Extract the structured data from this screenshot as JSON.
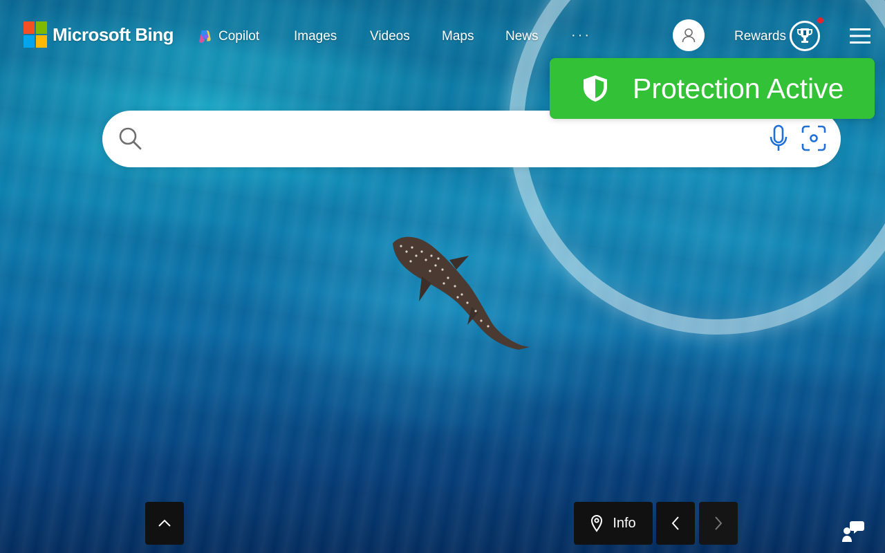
{
  "brand": {
    "name": "Microsoft Bing",
    "logo_colors": [
      "#f25022",
      "#7fba00",
      "#00a4ef",
      "#ffb900"
    ]
  },
  "nav": {
    "items": [
      {
        "label": "Copilot",
        "icon": "copilot-icon"
      },
      {
        "label": "Images"
      },
      {
        "label": "Videos"
      },
      {
        "label": "Maps"
      },
      {
        "label": "News"
      }
    ],
    "more_label": "···"
  },
  "account": {
    "profile_icon": "user-icon",
    "rewards_label": "Rewards",
    "rewards_icon": "trophy-icon",
    "notification_color": "#e3262c",
    "menu_icon": "hamburger-menu-icon"
  },
  "protection": {
    "label": "Protection Active",
    "icon": "shield-icon",
    "color": "#33c137"
  },
  "search": {
    "value": "",
    "placeholder": "",
    "search_icon": "search-icon",
    "mic_icon": "microphone-icon",
    "visual_search_icon": "visual-search-icon"
  },
  "background": {
    "subject": "whale-shark-in-ocean"
  },
  "bottom_controls": {
    "scroll_up_icon": "chevron-up-icon",
    "info_label": "Info",
    "info_icon": "location-pin-icon",
    "prev_icon": "chevron-left-icon",
    "next_icon": "chevron-right-icon",
    "feedback_icon": "feedback-icon"
  }
}
